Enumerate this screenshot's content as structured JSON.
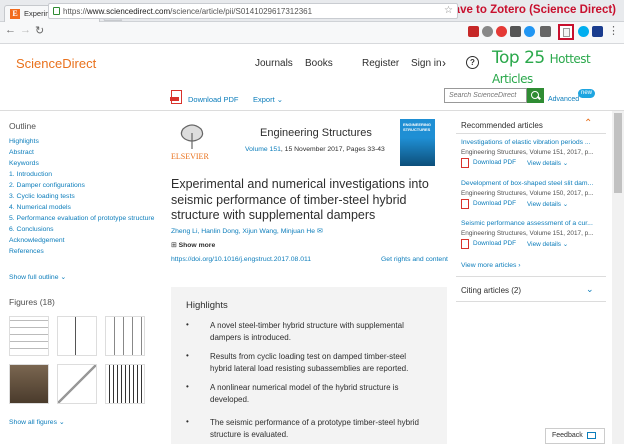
{
  "browser": {
    "tab_title": "Experimental and num",
    "tab_favicon": "E",
    "url_prefix": "https://",
    "url_host": "www.sciencedirect.com",
    "url_path": "/science/article/pii/S0141029617312361",
    "overlay_label": "Save to Zotero (Science Direct)"
  },
  "header": {
    "logo": "ScienceDirect",
    "nav": [
      "Journals",
      "Books",
      "Register",
      "Sign in"
    ],
    "help": "?",
    "promo_main": "Top 25",
    "promo_sub": "Hottest Articles"
  },
  "toolbar": {
    "download_pdf": "Download PDF",
    "export": "Export",
    "search_placeholder": "Search ScienceDirect",
    "advanced": "Advanced",
    "new_badge": "new"
  },
  "outline": {
    "heading": "Outline",
    "items": [
      "Highlights",
      "Abstract",
      "Keywords",
      "1. Introduction",
      "2. Damper configurations",
      "3. Cyclic loading tests",
      "4. Numerical models",
      "5. Performance evaluation of prototype structure",
      "6. Conclusions",
      "Acknowledgement",
      "References"
    ],
    "show_full": "Show full outline"
  },
  "figures": {
    "heading": "Figures (18)",
    "show_all": "Show all figures"
  },
  "article": {
    "journal": "Engineering Structures",
    "volume_link": "Volume 151",
    "issue_info": ", 15 November 2017, Pages 33-43",
    "publisher": "ELSEVIER",
    "cover_text": "ENGINEERING STRUCTURES",
    "title": "Experimental and numerical investigations into seismic performance of timber-steel hybrid structure with supplemental dampers",
    "authors": "Zheng Li, Hanlin Dong, Xijun Wang, Minjuan He",
    "show_more": "Show more",
    "doi": "https://doi.org/10.1016/j.engstruct.2017.08.011",
    "rights": "Get rights and content"
  },
  "highlights": {
    "heading": "Highlights",
    "items": [
      "A novel steel-timber hybrid structure with supplemental dampers is introduced.",
      "Results from cyclic loading test on damped timber-steel hybrid lateral load resisting subassemblies are reported.",
      "A nonlinear numerical model of the hybrid structure is developed.",
      "The seismic performance of a prototype timber-steel hybrid structure is evaluated."
    ]
  },
  "recommended": {
    "heading": "Recommended articles",
    "items": [
      {
        "title": "Investigations of elastic vibration periods ...",
        "meta": "Engineering Structures, Volume 151, 2017, p..."
      },
      {
        "title": "Development of box-shaped steel slit dam...",
        "meta": "Engineering Structures, Volume 150, 2017, p..."
      },
      {
        "title": "Seismic performance assessment of a cur...",
        "meta": "Engineering Structures, Volume 151, 2017, p..."
      }
    ],
    "download_pdf": "Download PDF",
    "view_details": "View details",
    "view_more": "View more articles"
  },
  "citing": {
    "heading": "Citing articles (2)"
  },
  "feedback": "Feedback"
}
